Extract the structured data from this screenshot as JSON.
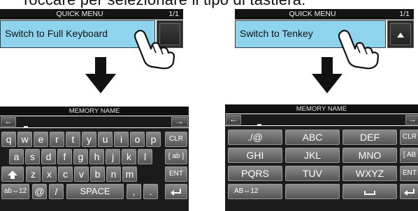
{
  "heading": "Toccare per selezionare il tipo di tastiera.",
  "left_menu": {
    "title": "QUICK MENU",
    "page": "1/1",
    "item": "Switch to Full Keyboard"
  },
  "right_menu": {
    "title": "QUICK MENU",
    "page": "1/1",
    "item": "Switch to Tenkey"
  },
  "left_keyboard": {
    "title": "MEMORY NAME",
    "back_arrow": "←",
    "fwd_arrow": "→",
    "row1": [
      "q",
      "w",
      "e",
      "r",
      "t",
      "y",
      "u",
      "i",
      "o",
      "p"
    ],
    "row2": [
      "a",
      "s",
      "d",
      "f",
      "g",
      "h",
      "j",
      "k",
      "l"
    ],
    "row3": [
      "z",
      "x",
      "c",
      "v",
      "b",
      "n",
      "m"
    ],
    "clr": "CLR",
    "ab": "[ ab ]",
    "ent": "ENT",
    "mode": "ab⇔12",
    "at": "@",
    "slash": "/",
    "space": "SPACE",
    "comma": ",",
    "period": "."
  },
  "right_keyboard": {
    "title": "MEMORY NAME",
    "back_arrow": "←",
    "fwd_arrow": "→",
    "grid": [
      [
        "./@",
        "ABC",
        "DEF"
      ],
      [
        "GHI",
        "JKL",
        "MNO"
      ],
      [
        "PQRS",
        "TUV",
        "WXYZ"
      ]
    ],
    "clr": "CLR",
    "ab": "[ AB",
    "ent": "ENT",
    "mode": "AB⇔12"
  },
  "colors": {
    "menu_item": "#8fd4ee",
    "key": "#6e6e6e",
    "screen": "#1b1b1b"
  }
}
